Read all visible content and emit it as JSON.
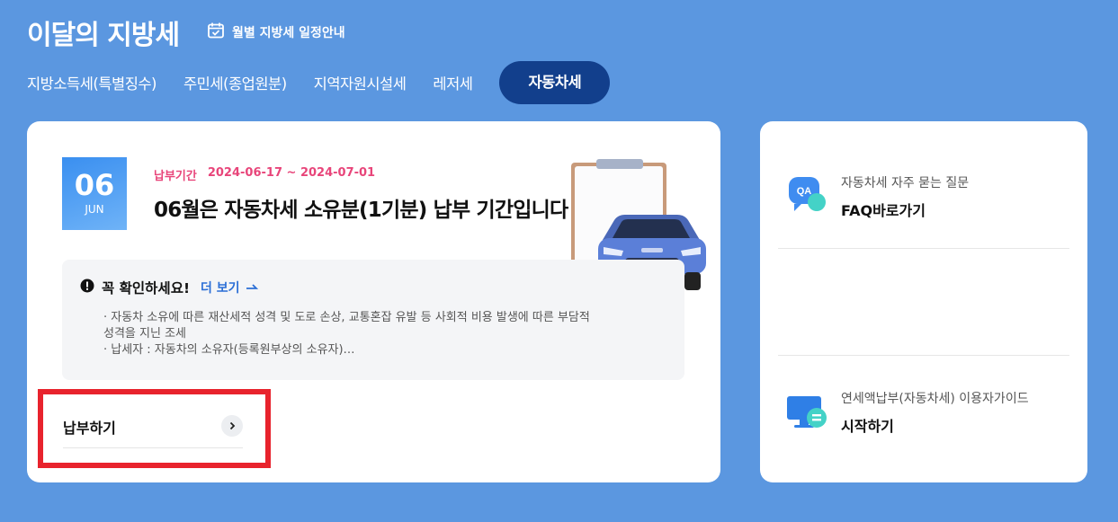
{
  "header": {
    "title": "이달의 지방세",
    "schedule_link": "월별 지방세 일정안내"
  },
  "tabs": [
    {
      "label": "지방소득세(특별징수)",
      "active": false
    },
    {
      "label": "주민세(종업원분)",
      "active": false
    },
    {
      "label": "지역자원시설세",
      "active": false
    },
    {
      "label": "레저세",
      "active": false
    },
    {
      "label": "자동차세",
      "active": true
    }
  ],
  "main": {
    "date_day": "06",
    "date_month": "JUN",
    "period_label": "납부기간",
    "period_value": "2024-06-17 ~ 2024-07-01",
    "headline": "06월은 자동차세 소유분(1기분) 납부 기간입니다",
    "notice": {
      "title": "꼭 확인하세요!",
      "more_label": "더 보기",
      "line1": "· 자동차 소유에 따른 재산세적 성격 및 도로 손상, 교통혼잡 유발 등 사회적 비용 발생에 따른 부담적",
      "line2": "성격을 지닌 조세",
      "line3": "· 납세자 : 자동차의 소유자(등록원부상의 소유자)…"
    },
    "pay_label": "납부하기"
  },
  "side": {
    "faq_sub": "자동차세 자주 묻는 질문",
    "faq_main": "FAQ바로가기",
    "faq_icon_text": "QA",
    "guide_sub": "연세액납부(자동차세) 이용자가이드",
    "guide_main": "시작하기"
  },
  "colors": {
    "background": "#5b97e0",
    "active_tab": "#123f8c",
    "period": "#e8457a",
    "link": "#2c6fd6",
    "highlight": "#e8232d"
  }
}
